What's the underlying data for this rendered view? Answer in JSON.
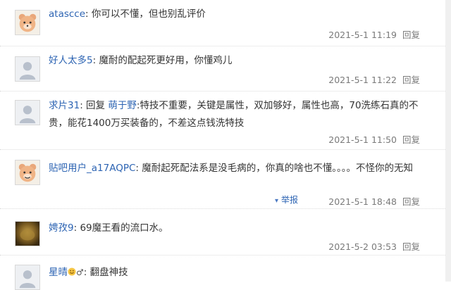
{
  "comments": [
    {
      "username": "atascce",
      "sep": ": ",
      "content": "你可以不懂，但也别乱评价",
      "timestamp": "2021-5-1 11:19",
      "reply_label": "回复",
      "avatar": "cartoon-bear-avatar"
    },
    {
      "username": "好人太多5",
      "sep": ": ",
      "content": "魔耐的配起死更好用，你懂鸡儿",
      "timestamp": "2021-5-1 11:22",
      "reply_label": "回复",
      "avatar": "default-avatar"
    },
    {
      "username": "求片31",
      "sep": ": ",
      "reply_prefix": "回复",
      "mention": "萌于野",
      "content": ":特技不重要，关键是属性，双加够好，属性也高，70洗练石真的不贵，能花1400万买装备的，不差这点钱洗特技",
      "timestamp": "2021-5-1 11:50",
      "reply_label": "回复",
      "avatar": "default-avatar"
    },
    {
      "username": "贴吧用户_a17AQPC",
      "sep": ": ",
      "content": "魔耐起死配法系是没毛病的，你真的啥也不懂。。。。不怪你的无知",
      "timestamp": "2021-5-1 18:48",
      "reply_label": "回复",
      "report_label": "举报",
      "avatar": "cartoon-bear-avatar"
    },
    {
      "username": "娉孜9",
      "sep": ": ",
      "content": "69魔王看的流口水。",
      "timestamp": "2021-5-2 03:53",
      "reply_label": "回复",
      "avatar": "photo-avatar"
    },
    {
      "username": "星晴",
      "sep": ": ",
      "content": "翻盘神技",
      "avatar": "default-avatar"
    }
  ],
  "colors": {
    "username": "#2d64b3",
    "text": "#333333",
    "meta": "#7a7a7a"
  }
}
